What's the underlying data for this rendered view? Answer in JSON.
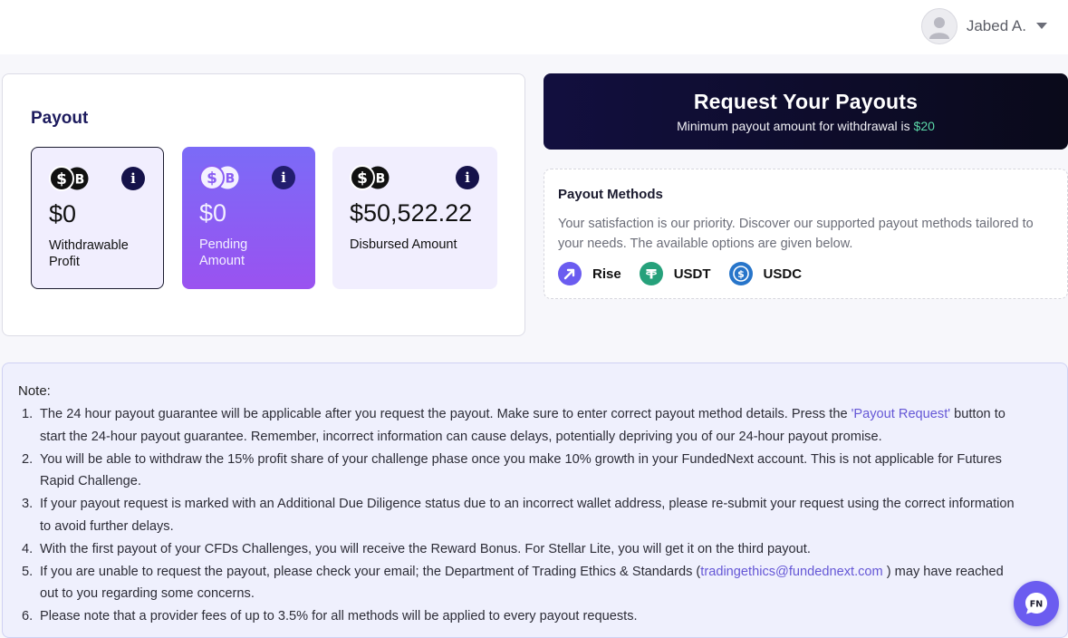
{
  "header": {
    "user_name": "Jabed A."
  },
  "payout": {
    "title": "Payout",
    "stats": [
      {
        "value": "$0",
        "label": "Withdrawable Profit"
      },
      {
        "value": "$0",
        "label": "Pending Amount"
      },
      {
        "value": "$50,522.22",
        "label": "Disbursed Amount"
      }
    ]
  },
  "request": {
    "title": "Request Your Payouts",
    "subtitle_prefix": "Minimum payout amount for withdrawal is ",
    "min_amount": "$20"
  },
  "methods": {
    "title": "Payout Methods",
    "description": "Your satisfaction is our priority. Discover our supported payout methods tailored to your needs. The available options are given below.",
    "items": [
      {
        "label": "Rise",
        "icon": "rise-icon",
        "color": "#6b5cf0"
      },
      {
        "label": "USDT",
        "icon": "tether-icon",
        "color": "#26a17b"
      },
      {
        "label": "USDC",
        "icon": "usdc-icon",
        "color": "#2775ca"
      }
    ]
  },
  "note": {
    "title": "Note:",
    "items": [
      {
        "num": "1.",
        "text_a": "The 24 hour payout guarantee will be applicable after you request the payout. Make sure to enter correct payout method details. Press the ",
        "link": "'Payout Request'",
        "text_b": " button to start the 24-hour payout guarantee. Remember, incorrect information can cause delays, potentially depriving you of our 24-hour payout promise."
      },
      {
        "num": "2.",
        "text": "You will be able to withdraw the 15% profit share of your challenge phase once you make 10% growth in your FundedNext account. This is not applicable for Futures Rapid Challenge."
      },
      {
        "num": "3.",
        "text": "If your payout request is marked with an Additional Due Diligence status due to an incorrect wallet address, please re-submit your request using the correct information to avoid further delays."
      },
      {
        "num": "4.",
        "text": "With the first payout of your CFDs Challenges, you will receive the Reward Bonus. For Stellar Lite, you will get it on the third payout."
      },
      {
        "num": "5.",
        "text_a": "If you are unable to request the payout, please check your email; the Department of Trading Ethics & Standards (",
        "link": "tradingethics@fundednext.com",
        "text_b": " ) may have reached out to you regarding some concerns."
      },
      {
        "num": "6.",
        "text": "Please note that a provider fees of up to 3.5% for all methods will be applied to every payout requests."
      }
    ]
  },
  "chat": {
    "label": "FN"
  },
  "colors": {
    "accent": "#6b5cf0",
    "navy": "#15124a",
    "positive": "#5bd8a8",
    "note_bg": "#eff0fd"
  }
}
